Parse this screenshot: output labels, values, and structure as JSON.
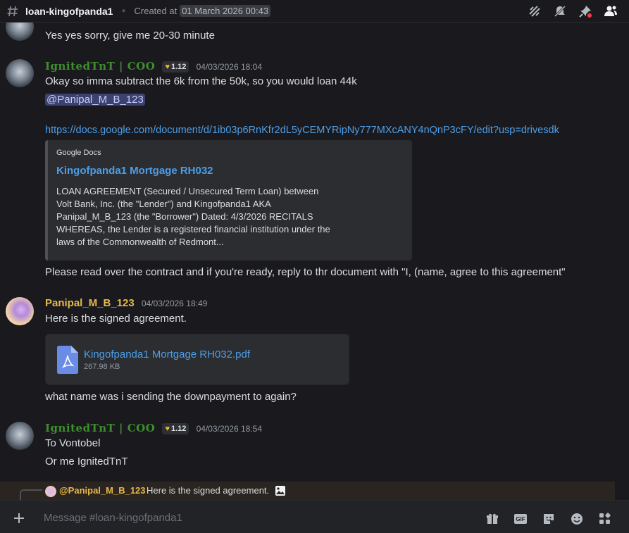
{
  "header": {
    "channel_name": "loan-kingofpanda1",
    "created_label": "Created at",
    "created_date": "01 March 2026 00:43"
  },
  "messages": [
    {
      "text": "Yes yes sorry, give me 20-30 minute"
    },
    {
      "author": "IgnitedTnT | COO",
      "badge": "1.12",
      "timestamp": "04/03/2026 18:04",
      "lines": [
        "Okay so imma subtract the 6k from the 50k, so you would loan 44k",
        "@Panipal_M_B_123",
        "https://docs.google.com/document/d/1ib03p6RnKfr2dL5yCEMYRipNy777MXcANY4nQnP3cFY/edit?usp=drivesdk"
      ],
      "embed": {
        "provider": "Google Docs",
        "title": "Kingofpanda1 Mortgage RH032",
        "description": "LOAN AGREEMENT (Secured / Unsecured Term Loan) between Volt Bank, Inc. (the \"Lender\") and Kingofpanda1 AKA Panipal_M_B_123 (the \"Borrower\") Dated: 4/3/2026 RECITALS WHEREAS, the Lender is a registered financial institution under the laws of the Commonwealth of Redmont..."
      },
      "followup": "Please read over the contract and if you're ready, reply to thr document with \"I, (name, agree to this agreement\""
    },
    {
      "author": "Panipal_M_B_123",
      "timestamp": "04/03/2026 18:49",
      "text": "Here is the signed agreement.",
      "attachment": {
        "name": "Kingofpanda1 Mortgage RH032.pdf",
        "size": "267.98 KB"
      },
      "followup": "what name was i sending the downpayment to again?"
    },
    {
      "author": "IgnitedTnT | COO",
      "badge": "1.12",
      "timestamp": "04/03/2026 18:54",
      "lines": [
        "To Vontobel",
        "Or me IgnitedTnT"
      ]
    }
  ],
  "reply": {
    "mention": "@Panipal_M_B_123",
    "text": "Here is the signed agreement."
  },
  "composer": {
    "placeholder": "Message #loan-kingofpanda1"
  },
  "icons": {
    "header": [
      "threads-icon",
      "mute-icon",
      "pin-icon",
      "members-icon"
    ],
    "composer": [
      "gift-icon",
      "gif-icon",
      "sticker-icon",
      "emoji-icon",
      "apps-icon"
    ]
  },
  "colors": {
    "background": "#1a1a1e",
    "link": "#4d9ee8",
    "ignited_name": "#3e8e2d",
    "panipal_name": "#e8b84a",
    "mention_bg": "#3c4270"
  }
}
